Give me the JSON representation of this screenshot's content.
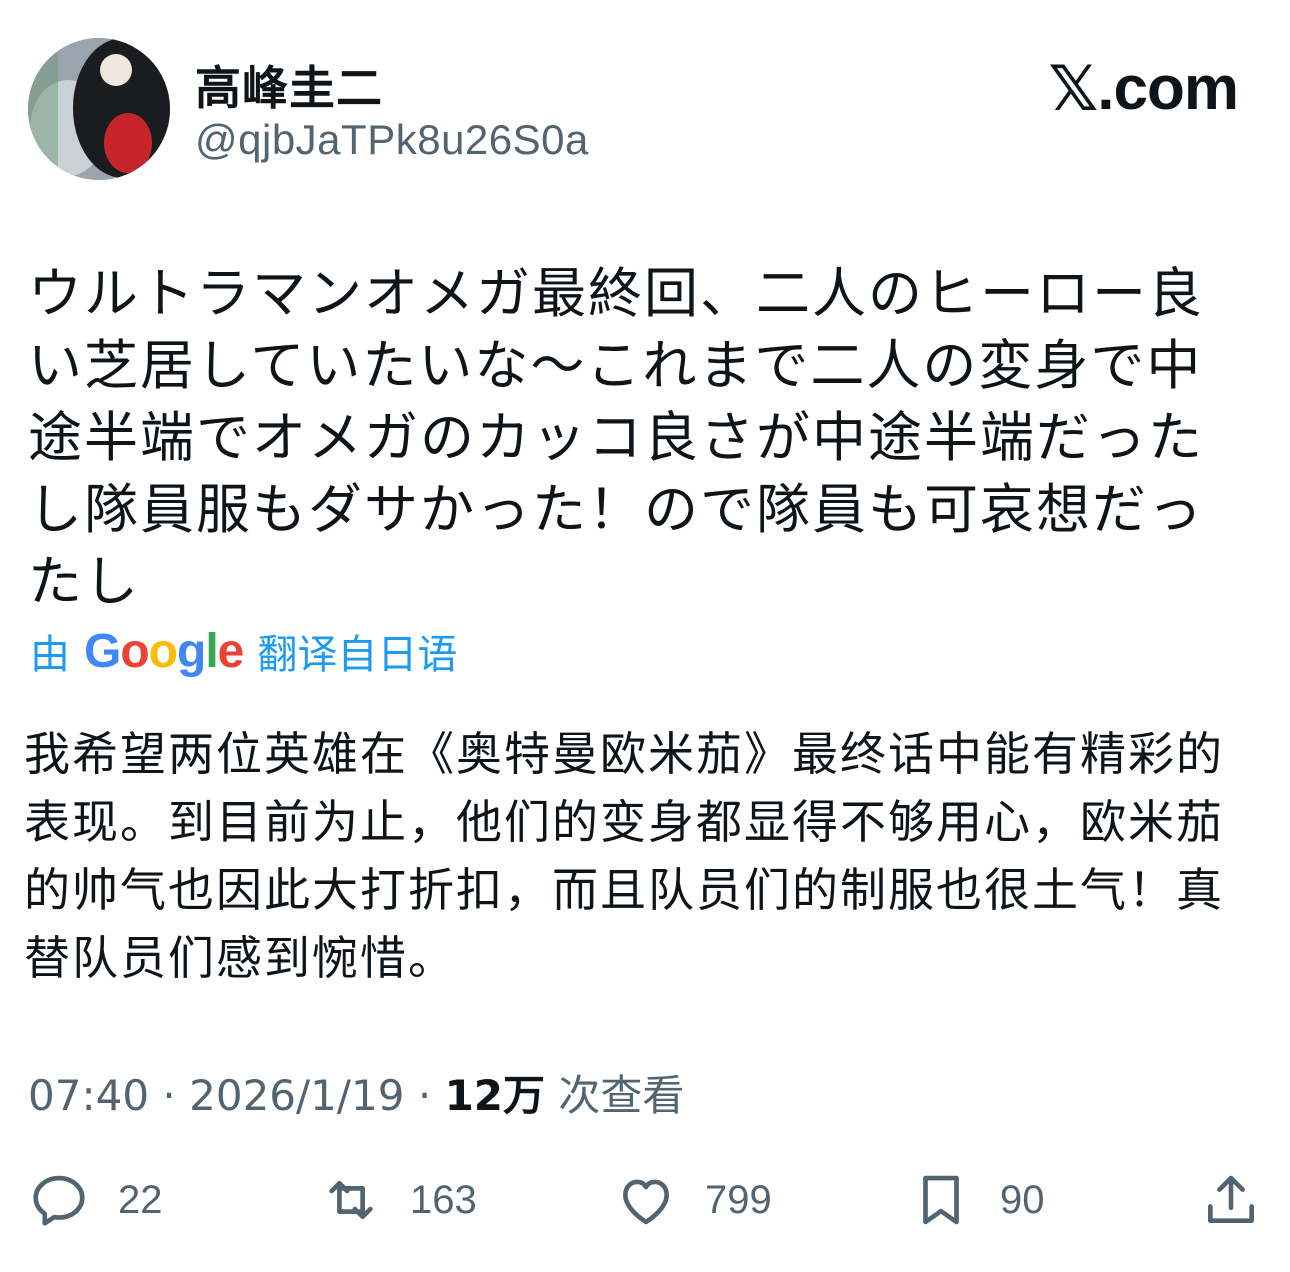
{
  "author": {
    "display_name": "高峰圭二",
    "handle": "@qjbJaTPk8u26S0a"
  },
  "brand": {
    "x_glyph": "𝕏",
    "suffix": ".com"
  },
  "tweet": {
    "text": "ウルトラマンオメガ最終回、二人のヒーロー良い芝居していたいな～これまで二人の変身で中途半端でオメガのカッコ良さが中途半端だったし隊員服もダサかった！ので隊員も可哀想だったし"
  },
  "translation": {
    "prefix": "由",
    "provider": "Google",
    "suffix": "翻译自日语",
    "text": "我希望两位英雄在《奥特曼欧米茄》最终话中能有精彩的表现。到目前为止，他们的变身都显得不够用心，欧米茄的帅气也因此大打折扣，而且队员们的制服也很土气！真替队员们感到惋惜。"
  },
  "meta": {
    "time": "07:40",
    "date": "2026/1/19",
    "views_count": "12万",
    "views_label": "次查看",
    "separator": "·"
  },
  "actions": {
    "reply": {
      "icon": "reply-icon",
      "count": "22"
    },
    "retweet": {
      "icon": "retweet-icon",
      "count": "163"
    },
    "like": {
      "icon": "heart-icon",
      "count": "799"
    },
    "bookmark": {
      "icon": "bookmark-icon",
      "count": "90"
    },
    "share": {
      "icon": "share-icon"
    }
  },
  "colors": {
    "text": "#0f1419",
    "secondary": "#536471",
    "accent": "#1d9bf0"
  }
}
